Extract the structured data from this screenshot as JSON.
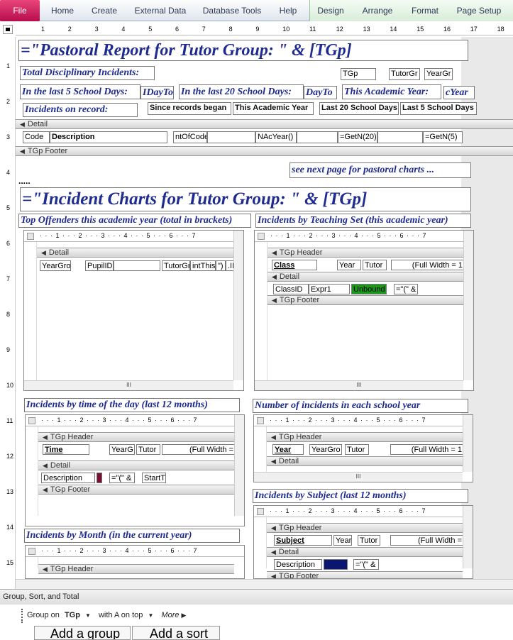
{
  "ribbon": {
    "file_label": "File",
    "tabs": [
      "Home",
      "Create",
      "External Data",
      "Database Tools",
      "Help"
    ],
    "context_tabs": [
      "Design",
      "Arrange",
      "Format",
      "Page Setup"
    ]
  },
  "ruler": {
    "numbers": [
      "1",
      "2",
      "3",
      "4",
      "5",
      "6",
      "7",
      "8",
      "9",
      "10",
      "11",
      "12",
      "13",
      "14",
      "15",
      "16",
      "17",
      "18"
    ],
    "vnumbers": [
      "1",
      "2",
      "3",
      "4",
      "5",
      "6",
      "7",
      "8",
      "9",
      "10",
      "11",
      "12",
      "13",
      "14",
      "15"
    ]
  },
  "report": {
    "title": "=\"Pastoral Report for Tutor Group:   \" & [TGp]",
    "total_disc": "Total Disciplinary Incidents:",
    "tgp_ctl": "TGp",
    "tutorgr_ctl": "TutorGr",
    "yeargr_ctl": "YearGr",
    "last5_label": "In the last 5 School Days:",
    "last5_value": "IDayTo",
    "last20_label": "In the last 20 School Days:",
    "last20_value": "DayTo",
    "academic_label": "This Academic Year:",
    "academic_value": "cYear",
    "on_record": "Incidents on record:",
    "col_since": "Since records began",
    "col_year": "This Academic Year",
    "col_last20": "Last 20 School Days",
    "col_last5": "Last 5 School Days",
    "detail_band": "Detail",
    "detail_code": "Code",
    "detail_desc": "Description",
    "detail_count": "ntOfCode",
    "detail_acyear": "NAcYear()",
    "detail_getn20": "=GetN(20)",
    "detail_getn5": "=GetN(5)",
    "footer_band": "TGp Footer",
    "see_next": "see next page for pastoral charts ...",
    "dots": ".....",
    "charts_title": "=\"Incident Charts for Tutor Group:   \" & [TGp]"
  },
  "subreports": {
    "offenders": {
      "caption": "Top Offenders this academic year (total in brackets)",
      "ruler": "· · · 1 · · · 2 · · · 3 · · · 4 · · · 5 · · · 6 · · · 7",
      "band": "Detail",
      "c1": "YearGro",
      "c2": "PupilID",
      "c3": "TutorGr",
      "c4": "intThis",
      "c5": "\")",
      "c6": ".IID"
    },
    "teachset": {
      "caption": "Incidents by Teaching Set (this academic year)",
      "band_header": "TGp Header",
      "class": "Class",
      "year": "Year",
      "tutor": "Tutor",
      "fullwidth": "(Full Width = 1",
      "band_detail": "Detail",
      "classid": "ClassID",
      "expr1": "Expr1",
      "unbound": "Unbound",
      "concat": "=\"(\" &",
      "band_footer": "TGp Footer"
    },
    "timeofday": {
      "caption": "Incidents by time of the day (last 12 months)",
      "band_header": "TGp Header",
      "time": "Time",
      "yearg": "YearG",
      "tutor": "Tutor",
      "fullwidth": "(Full Width =",
      "band_detail": "Detail",
      "desc": "Description",
      "concat": "=\"(\" &",
      "startt": "StartT",
      "band_footer": "TGp Footer"
    },
    "schoolyear": {
      "caption": "Number of incidents in each school year",
      "band_header": "TGp Header",
      "year": "Year",
      "yeargro": "YearGro",
      "tutor": "Tutor",
      "fullwidth": "(Full Width = 1",
      "band_detail": "Detail"
    },
    "subject": {
      "caption": "Incidents by Subject (last 12 months)",
      "band_header": "TGp Header",
      "subject": "Subject",
      "year": "Year",
      "tutor": "Tutor",
      "fullwidth": "(Full Width =",
      "band_detail": "Detail",
      "desc": "Description",
      "concat": "=\"(\" &",
      "band_footer": "TGp Footer"
    },
    "month": {
      "caption": "Incidents by Month (in the current year)",
      "band_header": "TGp Header"
    }
  },
  "gst": {
    "title": "Group, Sort, and Total",
    "group_on": "Group on",
    "group_field": "TGp",
    "with_a": "with A on top",
    "more": "More",
    "add_group": "Add a group",
    "add_sort": "Add a sort"
  },
  "colors": {
    "label_text": "#1f2b8f",
    "file_tab": "#c4124f",
    "unbound_fill": "#1a9a1a",
    "dark_fill": "#0b1670"
  }
}
